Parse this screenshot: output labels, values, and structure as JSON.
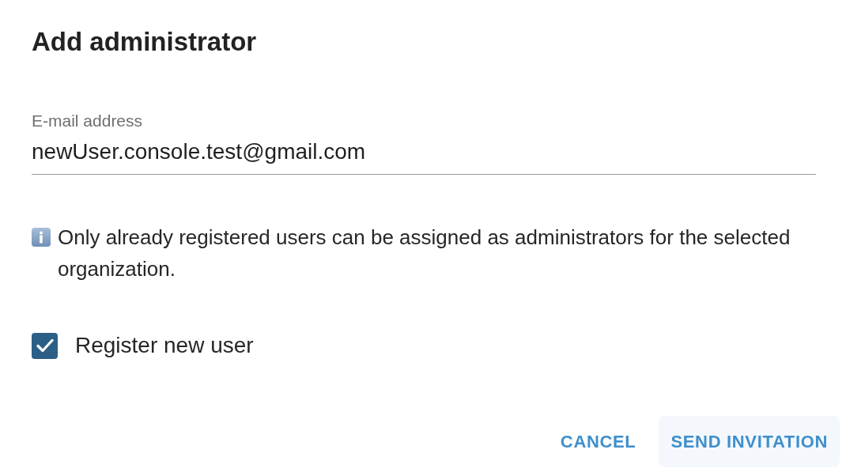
{
  "dialog": {
    "title": "Add administrator"
  },
  "email_field": {
    "label": "E-mail address",
    "value": "newUser.console.test@gmail.com"
  },
  "info": {
    "text": "Only already registered users can be assigned as administrators for the selected organization."
  },
  "register_checkbox": {
    "label": "Register new user",
    "checked": true
  },
  "buttons": [
    {
      "label": "CANCEL",
      "kind": "text"
    },
    {
      "label": "SEND INVITATION",
      "kind": "tonal"
    }
  ]
}
